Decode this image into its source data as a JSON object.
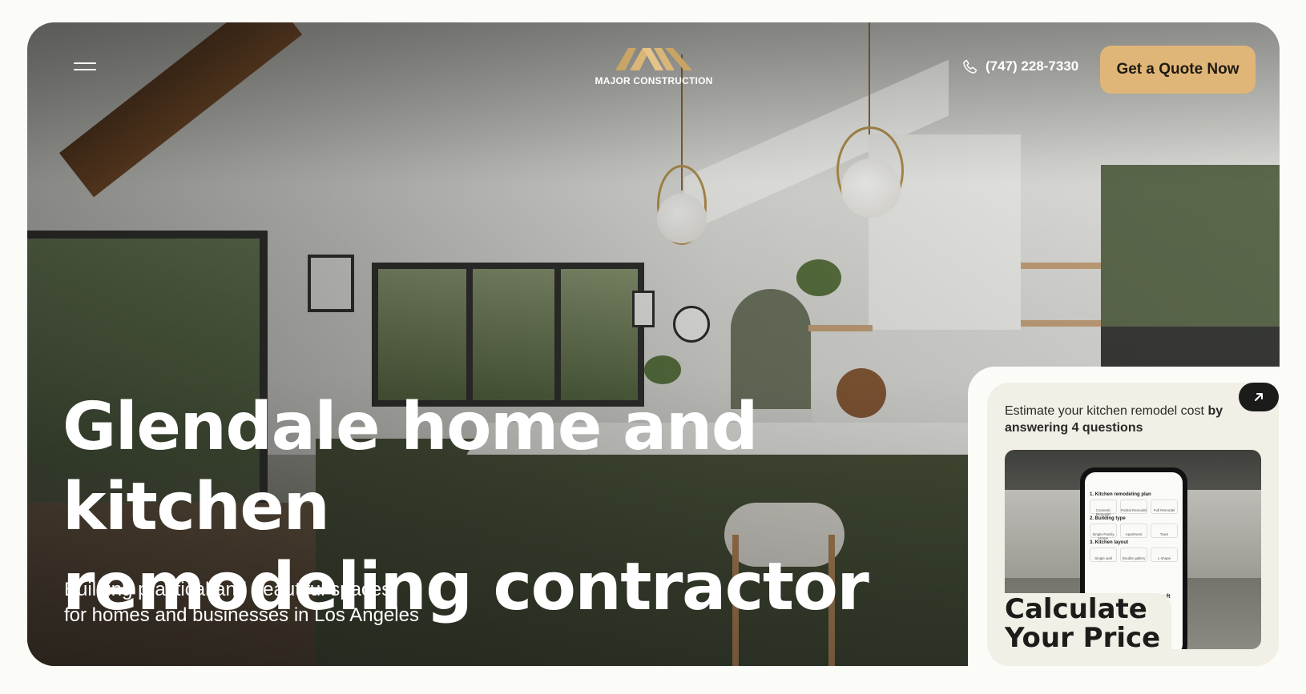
{
  "header": {
    "brand_name": "MAJOR CONSTRUCTION",
    "phone_number": "(747) 228-7330",
    "cta_label": "Get a Quote Now"
  },
  "hero": {
    "headline_line1": "Glendale home and kitchen",
    "headline_line2": "remodeling contractor",
    "subline_line1": "Building practical and beautiful spaces",
    "subline_line2": "for homes and businesses in Los Angeles"
  },
  "calculator_card": {
    "intro_text": "Estimate your kitchen remodel cost",
    "intro_bold": "by answering 4 questions",
    "title_line1": "Calculate",
    "title_line2": "Your Price",
    "phone_screen": {
      "step1": "1. Kitchen remodeling plan",
      "step1_options": [
        "Cosmetic Remodel",
        "Partial Remodel",
        "Full Remodel"
      ],
      "step2": "2. Building type",
      "step2_options": [
        "Single-Family Home",
        "Apartment",
        "Town"
      ],
      "step3": "3. Kitchen layout",
      "step3_options": [
        "Single wall",
        "Double gallery",
        "L-shape"
      ],
      "area": "125 sq ft"
    }
  },
  "colors": {
    "accent": "#e0b678",
    "dark": "#1b1b1a",
    "page_bg": "#fbfbf7",
    "card_bg": "#f1efe6"
  },
  "icons": {
    "menu": "menu-icon",
    "phone": "phone-icon",
    "arrow": "arrow-up-right-icon",
    "logo": "logo-mark-icon"
  }
}
